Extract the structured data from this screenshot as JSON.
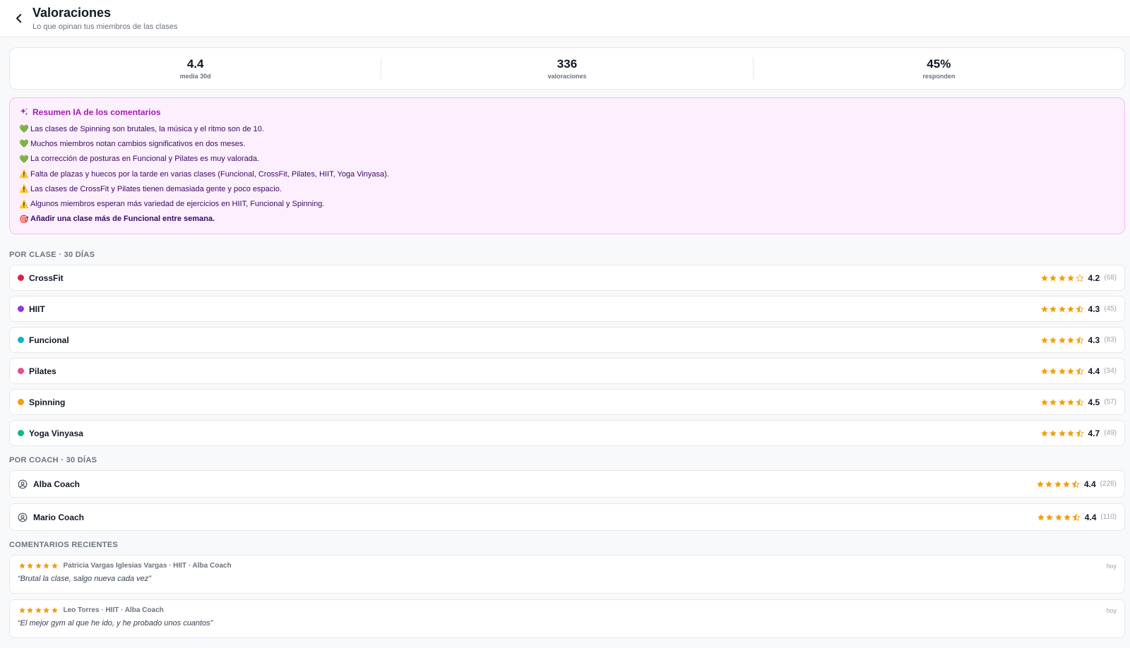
{
  "header": {
    "title": "Valoraciones",
    "subtitle": "Lo que opinan tus miembros de las clases"
  },
  "stats": [
    {
      "value": "4.4",
      "label": "media 30d"
    },
    {
      "value": "336",
      "label": "valoraciones"
    },
    {
      "value": "45%",
      "label": "responden"
    }
  ],
  "ai_summary": {
    "title": "Resumen IA de los comentarios",
    "accent": "#a21caf",
    "items": [
      {
        "emoji": "💚",
        "text": "Las clases de Spinning son brutales, la música y el ritmo son de 10."
      },
      {
        "emoji": "💚",
        "text": "Muchos miembros notan cambios significativos en dos meses."
      },
      {
        "emoji": "💚",
        "text": "La corrección de posturas en Funcional y Pilates es muy valorada."
      },
      {
        "emoji": "⚠️",
        "text": "Falta de plazas y huecos por la tarde en varias clases (Funcional, CrossFit, Pilates, HIIT, Yoga Vinyasa)."
      },
      {
        "emoji": "⚠️",
        "text": "Las clases de CrossFit y Pilates tienen demasiada gente y poco espacio."
      },
      {
        "emoji": "⚠️",
        "text": "Algunos miembros esperan más variedad de ejercicios en HIIT, Funcional y Spinning."
      },
      {
        "emoji": "🎯",
        "text": "Añadir una clase más de Funcional entre semana."
      }
    ]
  },
  "by_class": {
    "title": "POR CLASE · 30 DÍAS",
    "items": [
      {
        "name": "CrossFit",
        "color": "#e11d48",
        "rating": "4.2",
        "stars": 4.0,
        "count": "(68)"
      },
      {
        "name": "HIIT",
        "color": "#9333ea",
        "rating": "4.3",
        "stars": 4.5,
        "count": "(45)"
      },
      {
        "name": "Funcional",
        "color": "#06b6d4",
        "rating": "4.3",
        "stars": 4.5,
        "count": "(83)"
      },
      {
        "name": "Pilates",
        "color": "#ec4899",
        "rating": "4.4",
        "stars": 4.5,
        "count": "(34)"
      },
      {
        "name": "Spinning",
        "color": "#f59e0b",
        "rating": "4.5",
        "stars": 4.5,
        "count": "(57)"
      },
      {
        "name": "Yoga Vinyasa",
        "color": "#10b981",
        "rating": "4.7",
        "stars": 4.5,
        "count": "(49)"
      }
    ]
  },
  "by_coach": {
    "title": "POR COACH · 30 DÍAS",
    "items": [
      {
        "name": "Alba Coach",
        "icon": "user-circle-icon",
        "rating": "4.4",
        "stars": 4.5,
        "count": "(226)"
      },
      {
        "name": "Mario Coach",
        "icon": "user-circle-icon",
        "rating": "4.4",
        "stars": 4.5,
        "count": "(110)"
      }
    ]
  },
  "recent_comments": {
    "title": "COMENTARIOS RECIENTES",
    "items": [
      {
        "stars": 5,
        "meta": "Patricia Vargas Iglesias Vargas · HIIT · Alba Coach",
        "time": "hoy",
        "text": "“Brutal la clase, salgo nueva cada vez”"
      },
      {
        "stars": 5,
        "meta": "Leo Torres · HIIT · Alba Coach",
        "time": "hoy",
        "text": "“El mejor gym al que he ido, y he probado unos cuantos”"
      }
    ]
  },
  "colors": {
    "star": "#f59e0b",
    "star_empty": "#f59e0b"
  }
}
